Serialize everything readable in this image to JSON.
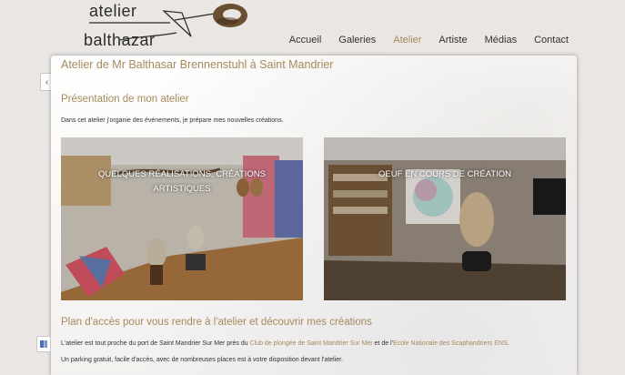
{
  "logo": {
    "line1": "atelier",
    "line2": "balthazar"
  },
  "nav": {
    "items": [
      {
        "label": "Accueil"
      },
      {
        "label": "Galeries"
      },
      {
        "label": "Atelier"
      },
      {
        "label": "Artiste"
      },
      {
        "label": "Médias"
      },
      {
        "label": "Contact"
      }
    ],
    "active_index": 2
  },
  "main": {
    "title": "Atelier de Mr Balthasar Brennenstuhl à Saint Mandrier",
    "intro_heading": "Présentation de mon atelier",
    "intro_text": "Dans cet atelier j'organie des événements, je prépare mes nouvelles créations.",
    "tiles": [
      {
        "caption": "QUELQUES RÉALISATIONS, CRÉATIONS ARTISTIQUES"
      },
      {
        "caption": "OEUF EN COURS DE CRÉATION"
      }
    ],
    "access_heading": "Plan d'accès pour vous rendre à l'atelier et découvrir mes créations",
    "access_text": {
      "part1": "L'atelier est tout proche du port de Saint Mandrier Sur Mer près du ",
      "link1": "Club de plongée de Saint Mandrier Sur Mer",
      "part2": " et de l'",
      "link2": "Ecole Nationale des Scaphandriers ENS",
      "part3": "."
    },
    "parking_text": "Un parking gratuit, facile d'accès, avec de nombreuses places est à votre disposition devant l'atelier."
  },
  "colors": {
    "accent": "#a58a5d",
    "text": "#333333",
    "background": "#e9e6e3"
  },
  "icons": {
    "side_arrow": "chevron-left-icon",
    "side_widget": "book-icon"
  }
}
